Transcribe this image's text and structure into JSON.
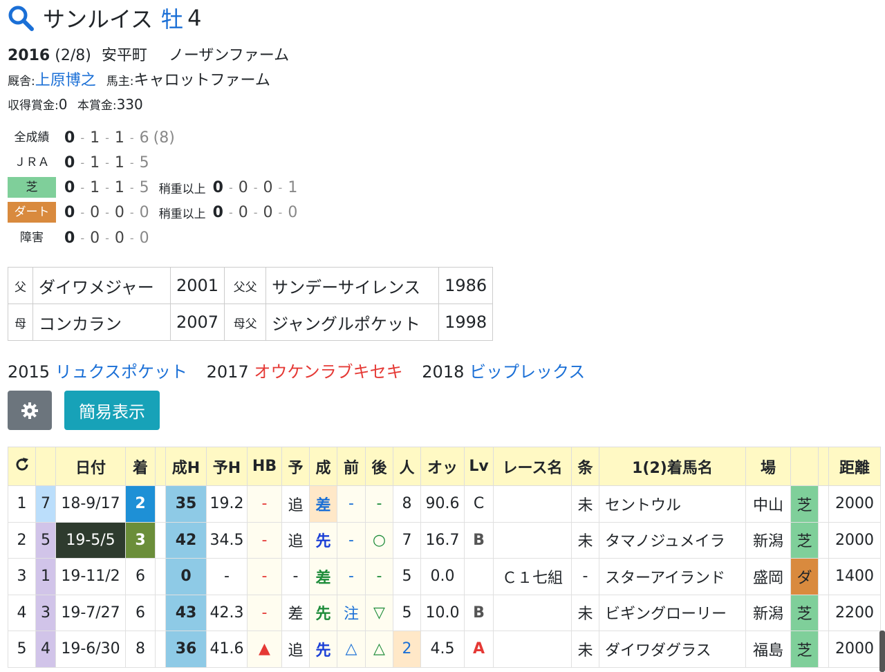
{
  "horse": {
    "name": "サンルイス",
    "sex": "牡",
    "age": "4",
    "birth_year": "2016",
    "birth_date": "(2/8)",
    "region": "安平町",
    "breeder": "ノーザンファーム",
    "stable_label": "厩舎:",
    "trainer": "上原博之",
    "owner_label": "馬主:",
    "owner": "キャロットファーム",
    "earnings_label": "収得賞金:",
    "earnings": "0",
    "prize_label": "本賞金:",
    "prize": "330"
  },
  "records": {
    "all": {
      "label": "全成績",
      "w": "0",
      "s": "1",
      "t": "1",
      "o": "6",
      "extra": "(8)"
    },
    "jra": {
      "label": "ＪＲＡ",
      "w": "0",
      "s": "1",
      "t": "1",
      "o": "5"
    },
    "turf": {
      "label": "芝",
      "w": "0",
      "s": "1",
      "t": "1",
      "o": "5",
      "heavy_label": "稍重以上",
      "hw": "0",
      "hs": "0",
      "ht": "0",
      "ho": "1"
    },
    "dirt": {
      "label": "ダート",
      "w": "0",
      "s": "0",
      "t": "0",
      "o": "0",
      "heavy_label": "稍重以上",
      "hw": "0",
      "hs": "0",
      "ht": "0",
      "ho": "0"
    },
    "hurdle": {
      "label": "障害",
      "w": "0",
      "s": "0",
      "t": "0",
      "o": "0"
    },
    "sep": "-"
  },
  "pedigree": {
    "sire_label": "父",
    "sire": "ダイワメジャー",
    "sire_year": "2001",
    "sire_sire_label": "父父",
    "sire_sire": "サンデーサイレンス",
    "sire_sire_year": "1986",
    "dam_label": "母",
    "dam": "コンカラン",
    "dam_year": "2007",
    "dam_sire_label": "母父",
    "dam_sire": "ジャングルポケット",
    "dam_sire_year": "1998"
  },
  "siblings": [
    {
      "year": "2015",
      "name": "リュクスポケット"
    },
    {
      "year": "2017",
      "name": "オウケンラブキセキ"
    },
    {
      "year": "2018",
      "name": "ビップレックス"
    }
  ],
  "buttons": {
    "simple_view": "簡易表示"
  },
  "table": {
    "headers": [
      "日付",
      "着",
      "成H",
      "予H",
      "HB",
      "予",
      "成",
      "前",
      "後",
      "人",
      "オッ",
      "Lv",
      "レース名",
      "条",
      "1(2)着馬名",
      "場",
      "距離"
    ],
    "rows": [
      {
        "no": "1",
        "frame": "7",
        "date": "18-9/17",
        "place": "2",
        "sh": "35",
        "yh": "19.2",
        "hb": "-",
        "yo": "追",
        "sei": "差",
        "mae": "-",
        "ato": "-",
        "pop": "8",
        "odds": "90.6",
        "lv": "C",
        "race": "",
        "cond": "未",
        "winner": "セントウル",
        "venue": "中山",
        "surface": "芝",
        "dist": "2000"
      },
      {
        "no": "2",
        "frame": "5",
        "date": "19-5/5",
        "place": "3",
        "sh": "42",
        "yh": "34.5",
        "hb": "-",
        "yo": "追",
        "sei": "先",
        "mae": "-",
        "ato": "○",
        "pop": "7",
        "odds": "16.7",
        "lv": "B",
        "race": "",
        "cond": "未",
        "winner": "タマノジュメイラ",
        "venue": "新潟",
        "surface": "芝",
        "dist": "2000"
      },
      {
        "no": "3",
        "frame": "1",
        "date": "19-11/2",
        "place": "6",
        "sh": "0",
        "yh": "-",
        "hb": "-",
        "yo": "-",
        "sei": "差",
        "mae": "-",
        "ato": "-",
        "pop": "5",
        "odds": "0.0",
        "lv": "",
        "race": "Ｃ１七組",
        "cond": "-",
        "winner": "スターアイランド",
        "venue": "盛岡",
        "surface": "ダ",
        "dist": "1400"
      },
      {
        "no": "4",
        "frame": "3",
        "date": "19-7/27",
        "place": "6",
        "sh": "43",
        "yh": "42.3",
        "hb": "-",
        "yo": "差",
        "sei": "先",
        "mae": "注",
        "ato": "▽",
        "pop": "5",
        "odds": "10.0",
        "lv": "B",
        "race": "",
        "cond": "未",
        "winner": "ビギングローリー",
        "venue": "新潟",
        "surface": "芝",
        "dist": "2200"
      },
      {
        "no": "5",
        "frame": "4",
        "date": "19-6/30",
        "place": "8",
        "sh": "36",
        "yh": "41.6",
        "hb": "▲",
        "yo": "追",
        "sei": "先",
        "mae": "△",
        "ato": "△",
        "pop": "2",
        "odds": "4.5",
        "lv": "A",
        "race": "",
        "cond": "未",
        "winner": "ダイワダグラス",
        "venue": "福島",
        "surface": "芝",
        "dist": "2000"
      }
    ]
  },
  "colors": {
    "link": "#1a6fd6",
    "red": "#e53935",
    "header_bg": "#fff9c4",
    "turf": "#7fcf9a",
    "dirt": "#d98a3e",
    "frame_blue": "#bbdefb",
    "frame_purple": "#d1c4e9"
  }
}
